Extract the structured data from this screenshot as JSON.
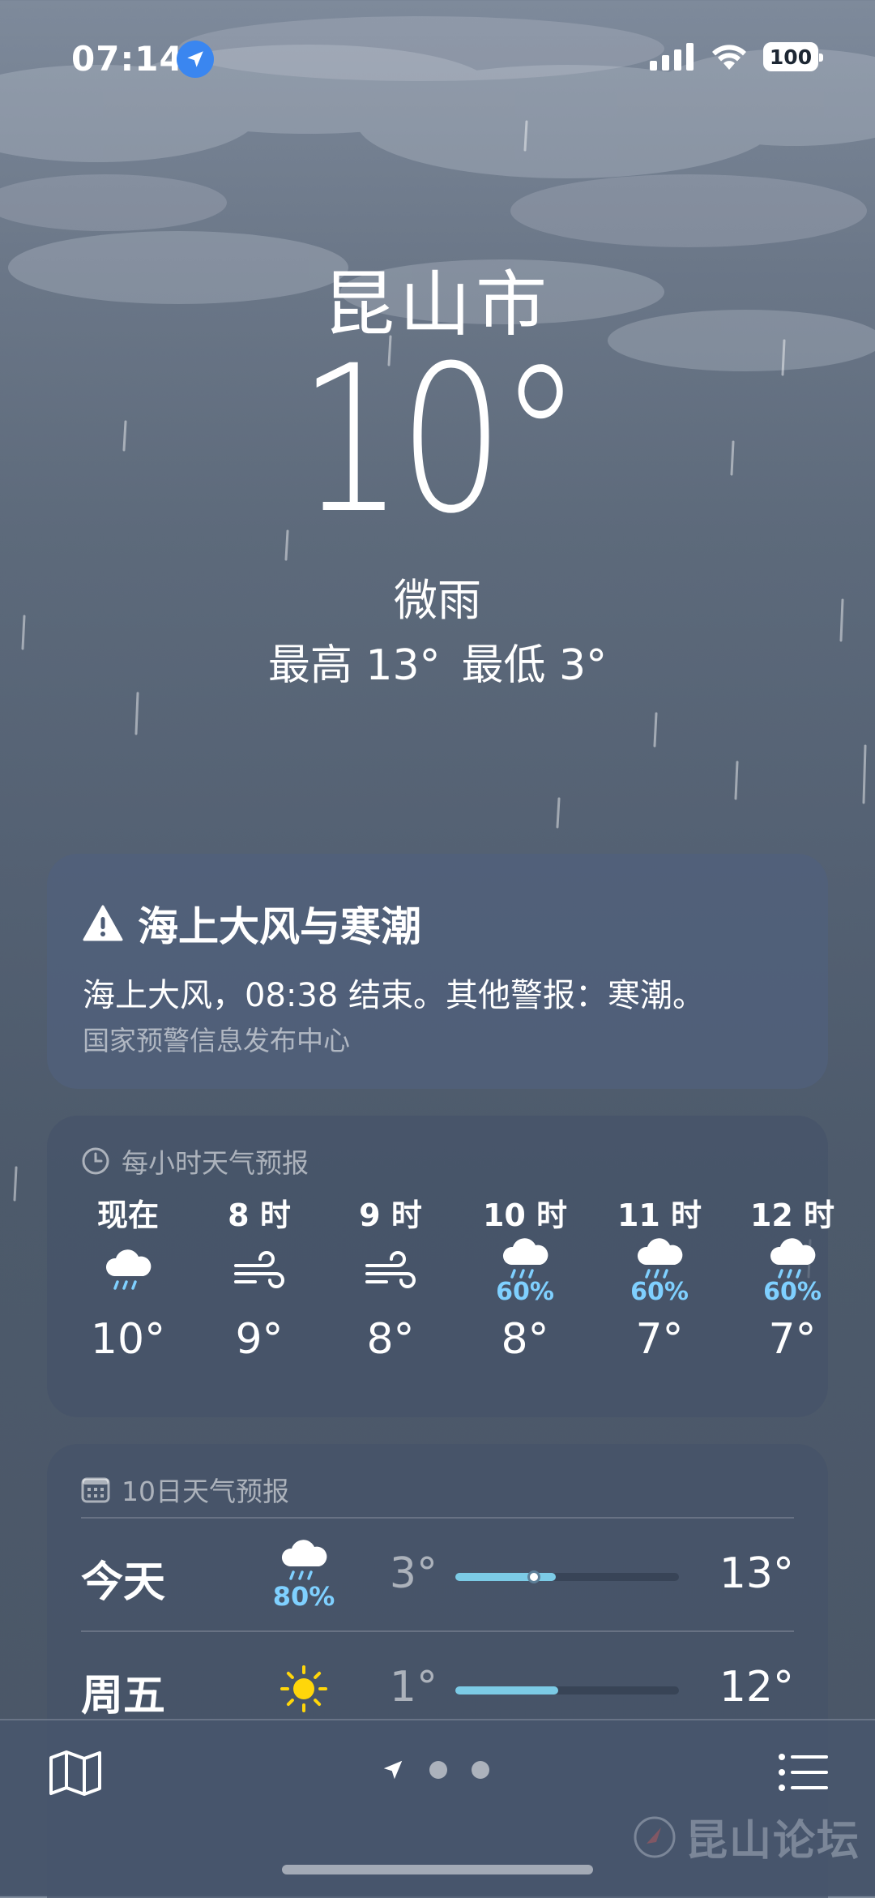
{
  "status": {
    "time": "07:14",
    "battery": "100"
  },
  "hero": {
    "city": "昆山市",
    "temp": "10°",
    "condition": "微雨",
    "high": "最高 13°",
    "low": "最低 3°"
  },
  "alert": {
    "title": "海上大风与寒潮",
    "body": "海上大风，08:38 结束。其他警报：寒潮。",
    "source": "国家预警信息发布中心"
  },
  "hourly": {
    "header": "每小时天气预报",
    "items": [
      {
        "label": "现在",
        "icon": "rain-cloud-icon",
        "pop": "",
        "temp": "10°"
      },
      {
        "label": "8 时",
        "icon": "wind-icon",
        "pop": "",
        "temp": "9°"
      },
      {
        "label": "9 时",
        "icon": "wind-icon",
        "pop": "",
        "temp": "8°"
      },
      {
        "label": "10 时",
        "icon": "rain-cloud-icon",
        "pop": "60%",
        "temp": "8°"
      },
      {
        "label": "11 时",
        "icon": "rain-cloud-icon",
        "pop": "60%",
        "temp": "7°"
      },
      {
        "label": "12 时",
        "icon": "rain-cloud-icon",
        "pop": "60%",
        "temp": "7°"
      }
    ]
  },
  "daily": {
    "header": "10日天气预报",
    "items": [
      {
        "day": "今天",
        "icon": "rain-cloud-icon",
        "pop": "80%",
        "low": "3°",
        "high": "13°",
        "range_start": 0.0,
        "range_end": 0.45,
        "current": 0.35
      },
      {
        "day": "周五",
        "icon": "sun-icon",
        "pop": "",
        "low": "1°",
        "high": "12°",
        "range_start": 0.0,
        "range_end": 0.46
      }
    ]
  },
  "colors": {
    "accent_pop": "#7fd0ff",
    "temp_bar": "#7ccbe6",
    "location_blue": "#3a86f0",
    "sun": "#ffd60a"
  },
  "watermark": "昆山论坛"
}
